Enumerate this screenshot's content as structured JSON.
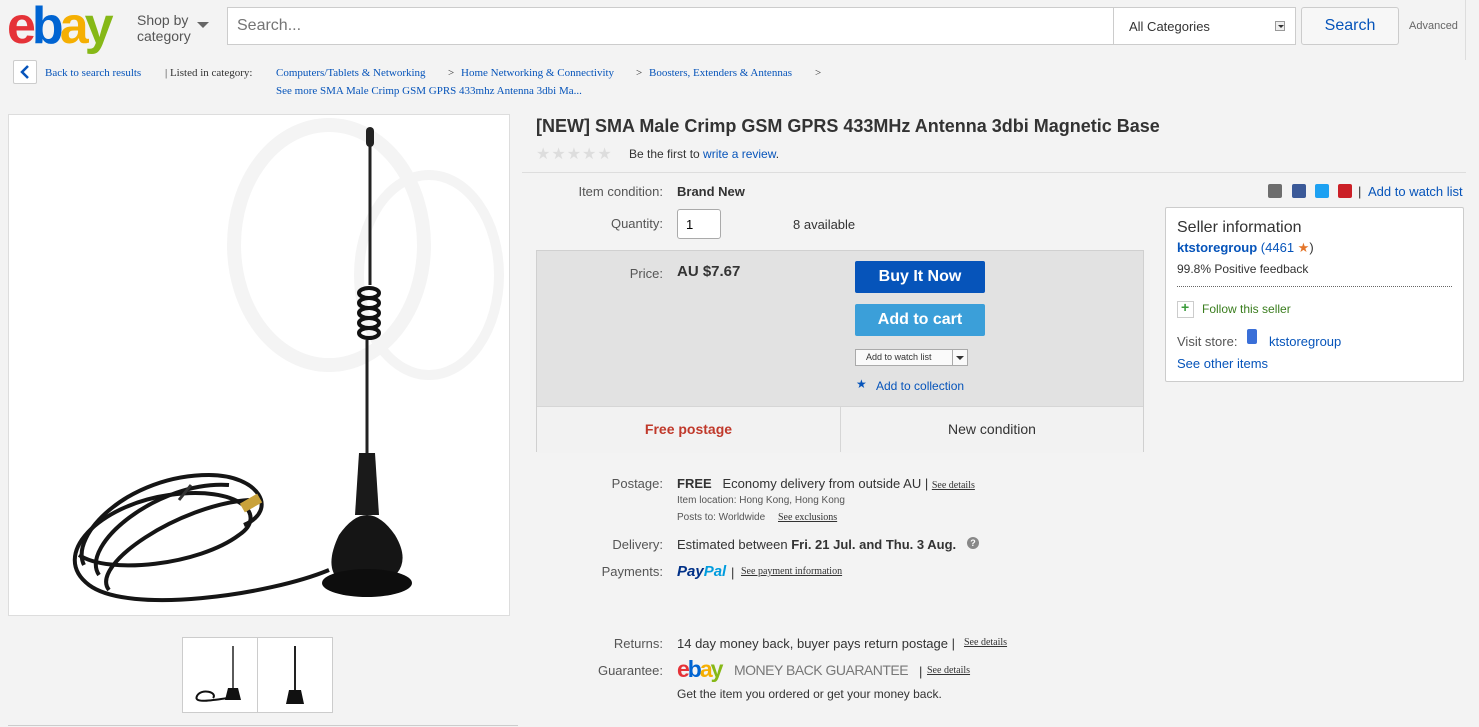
{
  "header": {
    "logo_letters": [
      "e",
      "b",
      "a",
      "y"
    ],
    "logo_colors": [
      "#e53238",
      "#0064d2",
      "#f5af02",
      "#86b817"
    ],
    "shop_by_line1": "Shop by",
    "shop_by_line2": "category",
    "search_placeholder": "Search...",
    "category_value": "All Categories",
    "search_button": "Search",
    "advanced_link": "Advanced"
  },
  "breadcrumb": {
    "back": "Back to search results",
    "listed": "| Listed in category:",
    "cat1": "Computers/Tablets & Networking",
    "cat2": "Home Networking & Connectivity",
    "cat3": "Boosters, Extenders & Antennas",
    "sep": ">",
    "see_more": "See more SMA Male Crimp GSM GPRS 433mhz Antenna 3dbi Ma..."
  },
  "product": {
    "title": "[NEW] SMA Male Crimp GSM GPRS 433MHz Antenna 3dbi Magnetic Base",
    "review_prefix": "Be the first to",
    "review_link": "write a review",
    "review_suffix": ".",
    "rating_stars": "★★★★★",
    "condition_label": "Item condition:",
    "condition_value": "Brand New",
    "quantity_label": "Quantity:",
    "quantity_value": "1",
    "available": "8 available",
    "price_label": "Price:",
    "price": "AU $7.67",
    "buy_now": "Buy It Now",
    "add_to_cart": "Add to cart",
    "add_to_watch_small": "Add to watch list",
    "add_to_collection": "Add to collection",
    "free_postage": "Free postage",
    "new_condition": "New condition",
    "watch_list_link": "Add to watch list"
  },
  "shipping": {
    "postage_label": "Postage:",
    "postage_free": "FREE",
    "postage_text": "Economy delivery from outside AU |",
    "see_details": "See details",
    "item_location": "Item location:  Hong Kong, Hong Kong",
    "posts_to": "Posts to:  Worldwide",
    "see_exclusions": "See exclusions",
    "delivery_label": "Delivery:",
    "delivery_prefix": "Estimated between",
    "delivery_dates": "Fri. 21 Jul. and Thu. 3 Aug.",
    "payments_label": "Payments:",
    "paypal_pay": "Pay",
    "paypal_pal": "Pal",
    "payments_sep": "|",
    "payment_info": "See payment information",
    "returns_label": "Returns:",
    "returns_text": "14 day money back, buyer pays return postage |",
    "returns_details": "See details",
    "guarantee_label": "Guarantee:",
    "guarantee_text": "MONEY BACK GUARANTEE",
    "guarantee_sep": "|",
    "guarantee_details": "See details",
    "guarantee_sub": "Get the item you ordered or get your money back."
  },
  "seller": {
    "title": "Seller information",
    "name": "ktstoregroup",
    "feedback_open": "(4461",
    "feedback_close": ")",
    "positive": "99.8% Positive feedback",
    "follow": "Follow this seller",
    "visit_store": "Visit store:",
    "store_name": "ktstoregroup",
    "other_items": "See other items"
  }
}
